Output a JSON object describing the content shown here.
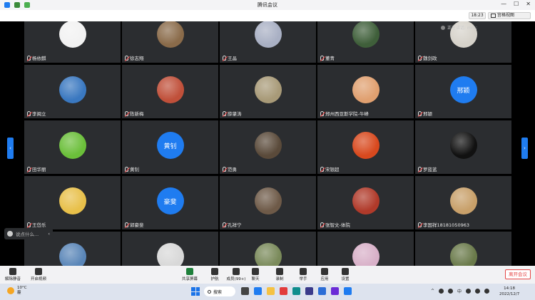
{
  "window": {
    "title": "腾讯会议",
    "clock": "18:23",
    "view_mode": "宫格视图",
    "speaking": "正在讲话: mrh;"
  },
  "participants": [
    {
      "name": "杨依麒",
      "avatar": "photo",
      "color": "#f2f2f2"
    },
    {
      "name": "徐志翔",
      "avatar": "photo",
      "color": "#8a6b4a"
    },
    {
      "name": "王晶",
      "avatar": "photo",
      "color": "#a9b0c4"
    },
    {
      "name": "董青",
      "avatar": "photo",
      "color": "#3f5f3a"
    },
    {
      "name": "魏剑政",
      "avatar": "photo",
      "color": "#d6d2ca"
    },
    {
      "name": "李闽立",
      "avatar": "photo",
      "color": "#3a78c0"
    },
    {
      "name": "陈新梅",
      "avatar": "photo",
      "color": "#c0503a"
    },
    {
      "name": "薛肇涛",
      "avatar": "photo",
      "color": "#a89a78"
    },
    {
      "name": "郑州西亚斯学院-牛峰",
      "avatar": "photo",
      "color": "#e0a070"
    },
    {
      "name": "邢颖",
      "avatar": "text",
      "text": "邢颖"
    },
    {
      "name": "田华丽",
      "avatar": "photo",
      "color": "#6bbf3a"
    },
    {
      "name": "黄钊",
      "avatar": "text",
      "text": "黄钊"
    },
    {
      "name": "范勇",
      "avatar": "photo",
      "color": "#5a4a3a"
    },
    {
      "name": "宋银超",
      "avatar": "photo",
      "color": "#d8491e"
    },
    {
      "name": "罗蓝蓝",
      "avatar": "photo",
      "color": "#111111"
    },
    {
      "name": "王岱乐",
      "avatar": "photo",
      "color": "#e8c04a"
    },
    {
      "name": "郭豪斐",
      "avatar": "text",
      "text": "豪斐"
    },
    {
      "name": "孔祥宁",
      "avatar": "photo",
      "color": "#6e5a48"
    },
    {
      "name": "张智文-体院",
      "avatar": "photo",
      "color": "#b03a2a"
    },
    {
      "name": "李国祥18181050963",
      "avatar": "photo",
      "color": "#c8a06a"
    },
    {
      "name": "",
      "avatar": "photo",
      "color": "#5a86b8"
    },
    {
      "name": "",
      "avatar": "photo",
      "color": "#d8d8d8"
    },
    {
      "name": "",
      "avatar": "photo",
      "color": "#7a8a5a"
    },
    {
      "name": "",
      "avatar": "photo",
      "color": "#d8b0c8"
    },
    {
      "name": "",
      "avatar": "photo",
      "color": "#6a7a4a"
    }
  ],
  "chat_hint": "说点什么...",
  "toolbar": {
    "left": [
      {
        "id": "mute",
        "label": "解除静音",
        "color": "#333333"
      },
      {
        "id": "video",
        "label": "开启视频",
        "color": "#333333"
      }
    ],
    "center": [
      {
        "id": "share",
        "label": "共享屏幕",
        "color": "#1e7f3a"
      },
      {
        "id": "protect",
        "label": "护航",
        "color": "#333333"
      },
      {
        "id": "members",
        "label": "成员(99+)",
        "color": "#333333"
      },
      {
        "id": "chat",
        "label": "聊天",
        "color": "#333333"
      },
      {
        "id": "record",
        "label": "录制",
        "color": "#333333"
      },
      {
        "id": "hand",
        "label": "举手",
        "color": "#333333"
      },
      {
        "id": "apps",
        "label": "应用",
        "color": "#333333"
      },
      {
        "id": "settings",
        "label": "设置",
        "color": "#333333"
      }
    ],
    "leave": "离开会议"
  },
  "taskbar": {
    "weather_temp": "10°C",
    "weather_desc": "霾",
    "search": "搜索",
    "ime": "中",
    "time": "14:18",
    "date": "2022/12/7"
  }
}
